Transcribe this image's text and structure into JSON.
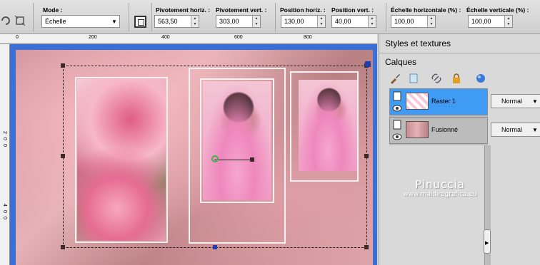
{
  "options_bar": {
    "mode": {
      "label": "Mode :",
      "value": "Échelle"
    },
    "fields": [
      {
        "label": "Pivotement horiz. :",
        "value": "563,50"
      },
      {
        "label": "Pivotement vert. :",
        "value": "303,00"
      },
      {
        "label": "Position horiz. :",
        "value": "130,00"
      },
      {
        "label": "Position vert. :",
        "value": "40,00"
      },
      {
        "label": "Échelle horizontale (%) :",
        "value": "100,00"
      },
      {
        "label": "Échelle verticale (%) :",
        "value": "100,00"
      }
    ]
  },
  "rulers": {
    "top": [
      "200",
      "400",
      "600",
      "800"
    ],
    "left": [
      "2",
      "0",
      "0",
      "4",
      "0",
      "0"
    ]
  },
  "panels": {
    "styles_title": "Styles et textures",
    "layers_title": "Calques",
    "layers": [
      {
        "name": "Raster 1",
        "blend_mode": "Normal",
        "selected": true
      },
      {
        "name": "Fusionné",
        "blend_mode": "Normal",
        "selected": false
      }
    ]
  },
  "watermark": {
    "line1": "Pinuccia",
    "line2": "www.maidiregrafica.eu"
  },
  "colors": {
    "selected_layer": "#3f9bf4",
    "workspace_bg": "#3a6fd6",
    "panel_bg": "#d9d9d9"
  },
  "icons": [
    "pan-icon",
    "transform-icon",
    "square-icon",
    "brush-icon",
    "layer-new-icon",
    "link-icon",
    "lock-icon",
    "globe-icon",
    "eye-icon",
    "layer-icon"
  ]
}
